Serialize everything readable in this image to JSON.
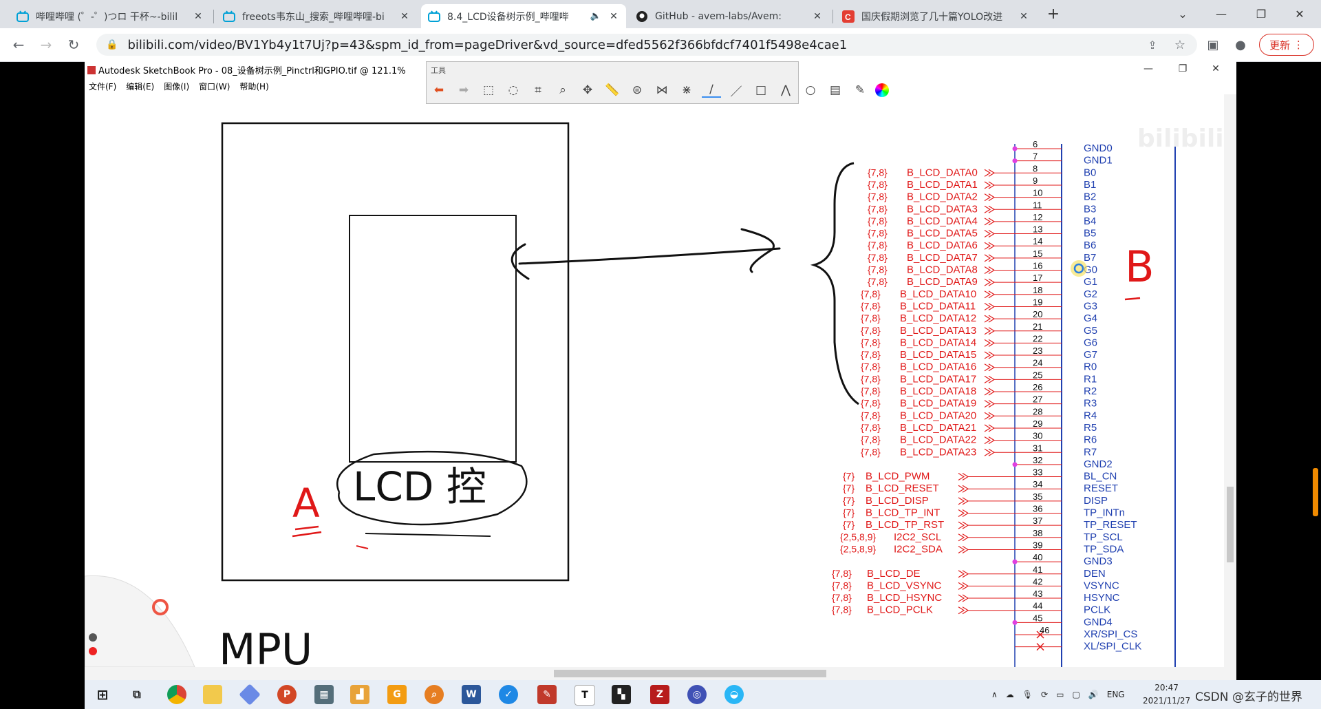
{
  "browser": {
    "tabs": [
      {
        "title": "哔哩哔哩 (゜-゜)つロ 干杯~-bilil",
        "active": false
      },
      {
        "title": "freeots韦东山_搜索_哔哩哔哩-bi",
        "active": false
      },
      {
        "title": "8.4_LCD设备树示例_哔哩哔",
        "active": true
      },
      {
        "title": "GitHub - avem-labs/Avem:",
        "active": false
      },
      {
        "title": "国庆假期浏览了几十篇YOLO改进",
        "active": false
      }
    ],
    "url": "bilibili.com/video/BV1Yb4y1t7Uj?p=43&spm_id_from=pageDriver&vd_source=dfed5562f366bfdcf7401f5498e4cae1",
    "update_label": "更新"
  },
  "sketchbook": {
    "title": "Autodesk SketchBook Pro - 08_设备树示例_Pinctrl和GPIO.tif @ 121.1%",
    "menu": [
      "文件(F)",
      "编辑(E)",
      "图像(I)",
      "窗口(W)",
      "帮助(H)"
    ],
    "toolbar_label": "工具"
  },
  "drawing": {
    "label_a": "A",
    "label_b": "B",
    "lcd_text": "LCD 控",
    "mpu_text": "MPU"
  },
  "schematic": {
    "left_rows": [
      {
        "ref": "{7,8}",
        "name": "B_LCD_DATA0",
        "pin": "8",
        "sig": "B0"
      },
      {
        "ref": "{7,8}",
        "name": "B_LCD_DATA1",
        "pin": "9",
        "sig": "B1"
      },
      {
        "ref": "{7,8}",
        "name": "B_LCD_DATA2",
        "pin": "10",
        "sig": "B2"
      },
      {
        "ref": "{7,8}",
        "name": "B_LCD_DATA3",
        "pin": "11",
        "sig": "B3"
      },
      {
        "ref": "{7,8}",
        "name": "B_LCD_DATA4",
        "pin": "12",
        "sig": "B4"
      },
      {
        "ref": "{7,8}",
        "name": "B_LCD_DATA5",
        "pin": "13",
        "sig": "B5"
      },
      {
        "ref": "{7,8}",
        "name": "B_LCD_DATA6",
        "pin": "14",
        "sig": "B6"
      },
      {
        "ref": "{7,8}",
        "name": "B_LCD_DATA7",
        "pin": "15",
        "sig": "B7"
      },
      {
        "ref": "{7,8}",
        "name": "B_LCD_DATA8",
        "pin": "16",
        "sig": "G0"
      },
      {
        "ref": "{7,8}",
        "name": "B_LCD_DATA9",
        "pin": "17",
        "sig": "G1"
      },
      {
        "ref": "{7,8}",
        "name": "B_LCD_DATA10",
        "pin": "18",
        "sig": "G2"
      },
      {
        "ref": "{7,8}",
        "name": "B_LCD_DATA11",
        "pin": "19",
        "sig": "G3"
      },
      {
        "ref": "{7,8}",
        "name": "B_LCD_DATA12",
        "pin": "20",
        "sig": "G4"
      },
      {
        "ref": "{7,8}",
        "name": "B_LCD_DATA13",
        "pin": "21",
        "sig": "G5"
      },
      {
        "ref": "{7,8}",
        "name": "B_LCD_DATA14",
        "pin": "22",
        "sig": "G6"
      },
      {
        "ref": "{7,8}",
        "name": "B_LCD_DATA15",
        "pin": "23",
        "sig": "G7"
      },
      {
        "ref": "{7,8}",
        "name": "B_LCD_DATA16",
        "pin": "24",
        "sig": "R0"
      },
      {
        "ref": "{7,8}",
        "name": "B_LCD_DATA17",
        "pin": "25",
        "sig": "R1"
      },
      {
        "ref": "{7,8}",
        "name": "B_LCD_DATA18",
        "pin": "26",
        "sig": "R2"
      },
      {
        "ref": "{7,8}",
        "name": "B_LCD_DATA19",
        "pin": "27",
        "sig": "R3"
      },
      {
        "ref": "{7,8}",
        "name": "B_LCD_DATA20",
        "pin": "28",
        "sig": "R4"
      },
      {
        "ref": "{7,8}",
        "name": "B_LCD_DATA21",
        "pin": "29",
        "sig": "R5"
      },
      {
        "ref": "{7,8}",
        "name": "B_LCD_DATA22",
        "pin": "30",
        "sig": "R6"
      },
      {
        "ref": "{7,8}",
        "name": "B_LCD_DATA23",
        "pin": "31",
        "sig": "R7"
      }
    ],
    "ctrl_rows": [
      {
        "ref": "{7}",
        "name": "B_LCD_PWM",
        "pin": "33",
        "sig": "BL_CN"
      },
      {
        "ref": "{7}",
        "name": "B_LCD_RESET",
        "pin": "34",
        "sig": "RESET"
      },
      {
        "ref": "{7}",
        "name": "B_LCD_DISP",
        "pin": "35",
        "sig": "DISP"
      },
      {
        "ref": "{7}",
        "name": "B_LCD_TP_INT",
        "pin": "36",
        "sig": "TP_INTn"
      },
      {
        "ref": "{7}",
        "name": "B_LCD_TP_RST",
        "pin": "37",
        "sig": "TP_RESET"
      },
      {
        "ref": "{2,5,8,9}",
        "name": "I2C2_SCL",
        "pin": "38",
        "sig": "TP_SCL"
      },
      {
        "ref": "{2,5,8,9}",
        "name": "I2C2_SDA",
        "pin": "39",
        "sig": "TP_SDA"
      }
    ],
    "sync_rows": [
      {
        "ref": "{7,8}",
        "name": "B_LCD_DE",
        "pin": "41",
        "sig": "DEN"
      },
      {
        "ref": "{7,8}",
        "name": "B_LCD_VSYNC",
        "pin": "42",
        "sig": "VSYNC"
      },
      {
        "ref": "{7,8}",
        "name": "B_LCD_HSYNC",
        "pin": "43",
        "sig": "HSYNC"
      },
      {
        "ref": "{7,8}",
        "name": "B_LCD_PCLK",
        "pin": "44",
        "sig": "PCLK"
      }
    ],
    "gnd_rows": [
      {
        "pin": "6",
        "sig": "GND0"
      },
      {
        "pin": "7",
        "sig": "GND1"
      },
      {
        "pin": "32",
        "sig": "GND2"
      },
      {
        "pin": "40",
        "sig": "GND3"
      },
      {
        "pin": "45",
        "sig": "GND4"
      }
    ],
    "tail_rows": [
      {
        "pin": "46",
        "sig": "XR/SPI_CS"
      },
      {
        "pin": "",
        "sig": "XL/SPI_CLK"
      }
    ]
  },
  "taskbar": {
    "tray_lang": "ENG",
    "time": "20:47",
    "date": "2021/11/27",
    "watermark": "CSDN @玄子的世界"
  },
  "colors": {
    "schematic_red": "#e01818",
    "schematic_blue": "#2040b0",
    "ink": "#111111"
  }
}
